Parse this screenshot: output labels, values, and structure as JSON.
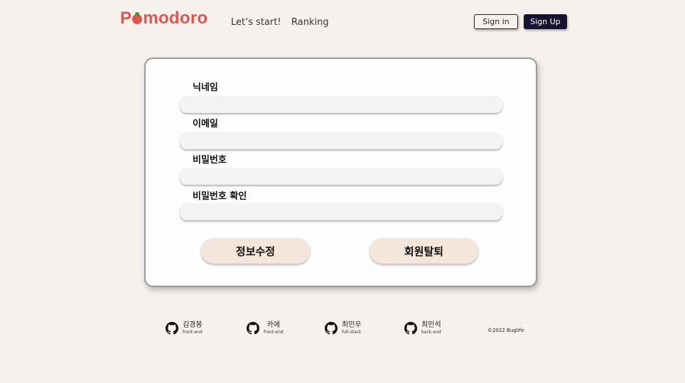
{
  "header": {
    "logo_pre": "P",
    "logo_post": "modoro",
    "nav": {
      "start": "Let’s start!",
      "ranking": "Ranking"
    },
    "signin_label": "Sign in",
    "signup_label": "Sign Up"
  },
  "form": {
    "fields": [
      {
        "label": "닉네임",
        "value": ""
      },
      {
        "label": "이메일",
        "value": ""
      },
      {
        "label": "비밀번호",
        "value": ""
      },
      {
        "label": "비밀번호 확인",
        "value": ""
      }
    ],
    "edit_label": "정보수정",
    "withdraw_label": "회원탈퇴"
  },
  "footer": {
    "members": [
      {
        "name": "김경봉",
        "role": "front-end"
      },
      {
        "name": "카에",
        "role": "front-end"
      },
      {
        "name": "최민우",
        "role": "full-stack"
      },
      {
        "name": "최민석",
        "role": "back-end"
      }
    ],
    "copyright": "©2022 Buglife"
  },
  "colors": {
    "brand": "#e0554e",
    "signup_bg": "#15132e",
    "button_bg": "#f5e6dc",
    "page_bg": "#f7f1ed"
  },
  "icons": {
    "member": "github-icon"
  }
}
